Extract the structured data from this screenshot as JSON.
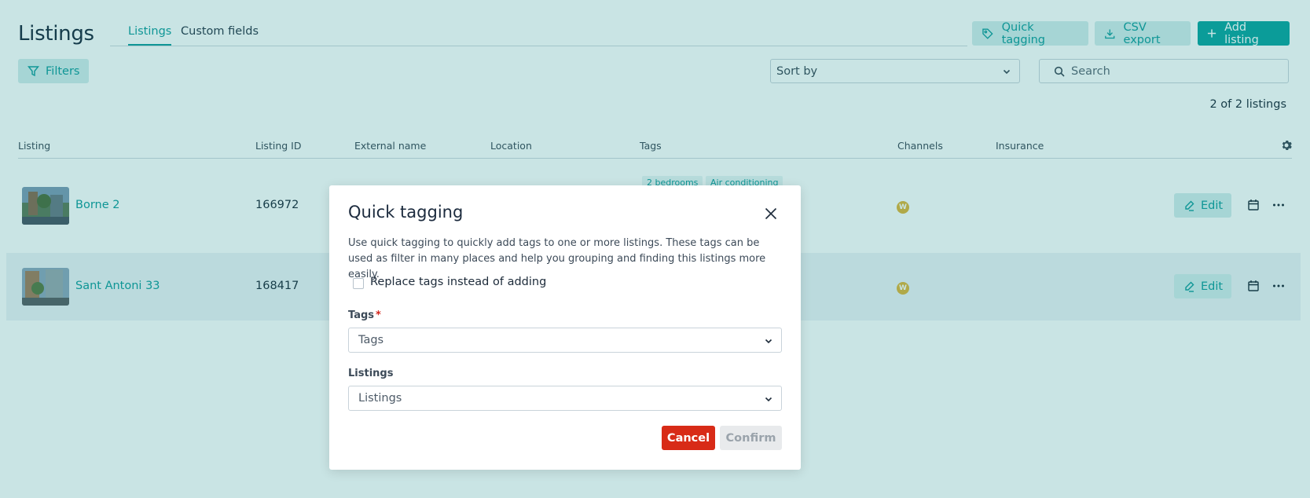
{
  "header": {
    "title": "Listings",
    "tabs": [
      {
        "label": "Listings",
        "active": true
      },
      {
        "label": "Custom fields",
        "active": false
      }
    ],
    "buttons": {
      "quick_tagging": "Quick tagging",
      "csv_export": "CSV export",
      "add_listing": "Add listing"
    }
  },
  "toolbar": {
    "filters_label": "Filters",
    "sort_placeholder": "Sort by",
    "search_placeholder": "Search"
  },
  "count_text": "2 of 2 listings",
  "table": {
    "columns": [
      "Listing",
      "Listing ID",
      "External name",
      "Location",
      "Tags",
      "Channels",
      "Insurance"
    ],
    "rows": [
      {
        "name": "Borne 2",
        "id": "166972",
        "tags": [
          "2 bedrooms",
          "Air conditioning"
        ],
        "channel": "W",
        "action": "Edit"
      },
      {
        "name": "Sant Antoni 33",
        "id": "168417",
        "tags": [],
        "channel": "W",
        "action": "Edit"
      }
    ]
  },
  "modal": {
    "title": "Quick tagging",
    "description": "Use quick tagging to quickly add tags to one or more listings. These tags can be used as filter in many places and help you grouping and finding this listings more easily.",
    "checkbox_label": "Replace tags instead of adding",
    "tags_label": "Tags",
    "tags_required": "*",
    "tags_placeholder": "Tags",
    "listings_label": "Listings",
    "listings_placeholder": "Listings",
    "cancel_label": "Cancel",
    "confirm_label": "Confirm"
  },
  "colors": {
    "accent": "#139c9c",
    "primary_button": "#0ea4a0",
    "danger": "#d82b17",
    "overlay": "rgba(0,126,126,0.21)",
    "channel_badge": "#e0b43a"
  }
}
